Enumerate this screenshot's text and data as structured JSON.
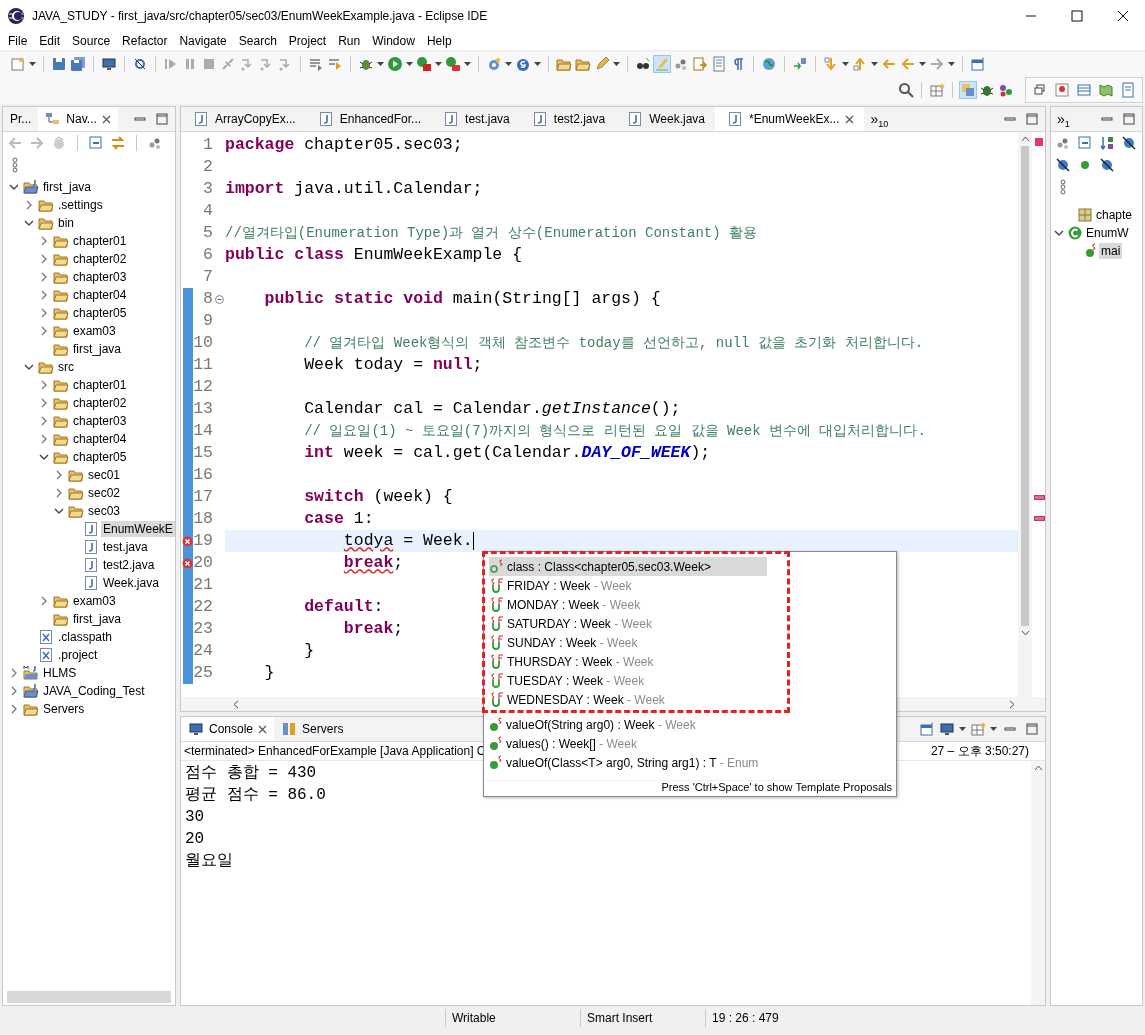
{
  "window": {
    "title": "JAVA_STUDY - first_java/src/chapter05/sec03/EnumWeekExample.java - Eclipse IDE"
  },
  "menu": [
    "File",
    "Edit",
    "Source",
    "Refactor",
    "Navigate",
    "Search",
    "Project",
    "Run",
    "Window",
    "Help"
  ],
  "navigator": {
    "tabs": [
      {
        "label": "Pr...",
        "selected": false
      },
      {
        "label": "Nav...",
        "selected": true
      }
    ],
    "tree": [
      {
        "label": "first_java",
        "kind": "project",
        "expandable": true,
        "expanded": true,
        "selected": false,
        "children": [
          {
            "label": ".settings",
            "kind": "folder",
            "expandable": true,
            "expanded": false,
            "selected": false
          },
          {
            "label": "bin",
            "kind": "folder",
            "expandable": true,
            "expanded": true,
            "selected": false,
            "children": [
              {
                "label": "chapter01",
                "kind": "folder",
                "expandable": true,
                "expanded": false,
                "selected": false
              },
              {
                "label": "chapter02",
                "kind": "folder",
                "expandable": true,
                "expanded": false,
                "selected": false
              },
              {
                "label": "chapter03",
                "kind": "folder",
                "expandable": true,
                "expanded": false,
                "selected": false
              },
              {
                "label": "chapter04",
                "kind": "folder",
                "expandable": true,
                "expanded": false,
                "selected": false
              },
              {
                "label": "chapter05",
                "kind": "folder",
                "expandable": true,
                "expanded": false,
                "selected": false
              },
              {
                "label": "exam03",
                "kind": "folder",
                "expandable": true,
                "expanded": false,
                "selected": false
              },
              {
                "label": "first_java",
                "kind": "folder",
                "expandable": false,
                "selected": false
              }
            ]
          },
          {
            "label": "src",
            "kind": "folder",
            "expandable": true,
            "expanded": true,
            "selected": false,
            "children": [
              {
                "label": "chapter01",
                "kind": "folder",
                "expandable": true,
                "expanded": false,
                "selected": false
              },
              {
                "label": "chapter02",
                "kind": "folder",
                "expandable": true,
                "expanded": false,
                "selected": false
              },
              {
                "label": "chapter03",
                "kind": "folder",
                "expandable": true,
                "expanded": false,
                "selected": false
              },
              {
                "label": "chapter04",
                "kind": "folder",
                "expandable": true,
                "expanded": false,
                "selected": false
              },
              {
                "label": "chapter05",
                "kind": "folder",
                "expandable": true,
                "expanded": true,
                "selected": false,
                "children": [
                  {
                    "label": "sec01",
                    "kind": "folder",
                    "expandable": true,
                    "expanded": false,
                    "selected": false
                  },
                  {
                    "label": "sec02",
                    "kind": "folder",
                    "expandable": true,
                    "expanded": false,
                    "selected": false
                  },
                  {
                    "label": "sec03",
                    "kind": "folder",
                    "expandable": true,
                    "expanded": true,
                    "selected": false,
                    "children": [
                      {
                        "label": "EnumWeekE",
                        "kind": "java",
                        "expandable": false,
                        "selected": true
                      },
                      {
                        "label": "test.java",
                        "kind": "java",
                        "expandable": false,
                        "selected": false
                      },
                      {
                        "label": "test2.java",
                        "kind": "java",
                        "expandable": false,
                        "selected": false
                      },
                      {
                        "label": "Week.java",
                        "kind": "java",
                        "expandable": false,
                        "selected": false
                      }
                    ]
                  }
                ]
              },
              {
                "label": "exam03",
                "kind": "folder",
                "expandable": true,
                "expanded": false,
                "selected": false
              },
              {
                "label": "first_java",
                "kind": "folder",
                "expandable": false,
                "selected": false
              }
            ]
          },
          {
            "label": ".classpath",
            "kind": "xml",
            "expandable": false,
            "selected": false
          },
          {
            "label": ".project",
            "kind": "xml",
            "expandable": false,
            "selected": false
          }
        ]
      },
      {
        "label": "HLMS",
        "kind": "project-maven",
        "expandable": true,
        "expanded": false,
        "selected": false
      },
      {
        "label": "JAVA_Coding_Test",
        "kind": "project",
        "expandable": true,
        "expanded": false,
        "selected": false
      },
      {
        "label": "Servers",
        "kind": "folder",
        "expandable": true,
        "expanded": false,
        "selected": false
      }
    ]
  },
  "editor": {
    "tabs": [
      {
        "label": "ArrayCopyEx...",
        "selected": false
      },
      {
        "label": "EnhancedFor...",
        "selected": false
      },
      {
        "label": "test.java",
        "selected": false
      },
      {
        "label": "test2.java",
        "selected": false
      },
      {
        "label": "Week.java",
        "selected": false
      },
      {
        "label": "*EnumWeekEx...",
        "selected": true
      }
    ],
    "overflow": {
      "glyph": "»",
      "count": "10"
    },
    "lines": [
      {
        "number": "1",
        "current": false,
        "error": false,
        "fold": false,
        "in_range": false,
        "segments": [
          {
            "kind": "keyword",
            "text": "package"
          },
          {
            "kind": "plain",
            "text": " chapter05.sec03;"
          }
        ]
      },
      {
        "number": "2",
        "current": false,
        "error": false,
        "fold": false,
        "in_range": false
      },
      {
        "number": "3",
        "current": false,
        "error": false,
        "fold": false,
        "in_range": false,
        "segments": [
          {
            "kind": "keyword",
            "text": "import"
          },
          {
            "kind": "plain",
            "text": " java.util.Calendar;"
          }
        ]
      },
      {
        "number": "4",
        "current": false,
        "error": false,
        "fold": false,
        "in_range": false
      },
      {
        "number": "5",
        "current": false,
        "error": false,
        "fold": false,
        "in_range": false,
        "segments": [
          {
            "kind": "comment",
            "text": "//열겨타입(Enumeration Type)과 열거 상수(Enumeration Constant) 활용"
          }
        ]
      },
      {
        "number": "6",
        "current": false,
        "error": false,
        "fold": false,
        "in_range": false,
        "segments": [
          {
            "kind": "keyword",
            "text": "public"
          },
          {
            "kind": "keyword",
            "text": " class"
          },
          {
            "kind": "plain",
            "text": " EnumWeekExample {"
          }
        ]
      },
      {
        "number": "7",
        "current": false,
        "error": false,
        "fold": false,
        "in_range": false
      },
      {
        "number": "8",
        "current": false,
        "error": false,
        "fold": true,
        "in_range": true,
        "segments": [
          {
            "kind": "keyword",
            "text": "    public"
          },
          {
            "kind": "keyword",
            "text": " static"
          },
          {
            "kind": "keyword",
            "text": " void"
          },
          {
            "kind": "plain",
            "text": " main(String[] args) {"
          }
        ]
      },
      {
        "number": "9",
        "current": false,
        "error": false,
        "fold": false,
        "in_range": true
      },
      {
        "number": "10",
        "current": false,
        "error": false,
        "fold": false,
        "in_range": true,
        "segments": [
          {
            "kind": "comment",
            "text": "        // 열겨타입 Week형식의 객체 참조변수 today를 선언하고, null 값을 초기화 처리합니다."
          }
        ]
      },
      {
        "number": "11",
        "current": false,
        "error": false,
        "fold": false,
        "in_range": true,
        "segments": [
          {
            "kind": "plain",
            "text": "        Week today = "
          },
          {
            "kind": "keyword",
            "text": "null"
          },
          {
            "kind": "plain",
            "text": ";"
          }
        ]
      },
      {
        "number": "12",
        "current": false,
        "error": false,
        "fold": false,
        "in_range": true
      },
      {
        "number": "13",
        "current": false,
        "error": false,
        "fold": false,
        "in_range": true,
        "segments": [
          {
            "kind": "plain",
            "text": "        Calendar cal = Calendar."
          },
          {
            "kind": "static-method",
            "text": "getInstance"
          },
          {
            "kind": "plain",
            "text": "();"
          }
        ]
      },
      {
        "number": "14",
        "current": false,
        "error": false,
        "fold": false,
        "in_range": true,
        "segments": [
          {
            "kind": "comment",
            "text": "        // 일요일(1) ~ 토요일(7)까지의 형식으로 리턴된 요일 값을 Week 변수에 대입처리합니다."
          }
        ]
      },
      {
        "number": "15",
        "current": false,
        "error": false,
        "fold": false,
        "in_range": true,
        "segments": [
          {
            "kind": "keyword",
            "text": "        int"
          },
          {
            "kind": "plain",
            "text": " week = cal.get(Calendar."
          },
          {
            "kind": "static-field",
            "text": "DAY_OF_WEEK"
          },
          {
            "kind": "plain",
            "text": ");"
          }
        ]
      },
      {
        "number": "16",
        "current": false,
        "error": false,
        "fold": false,
        "in_range": true
      },
      {
        "number": "17",
        "current": false,
        "error": false,
        "fold": false,
        "in_range": true,
        "segments": [
          {
            "kind": "keyword",
            "text": "        switch"
          },
          {
            "kind": "plain",
            "text": " (week) {"
          }
        ]
      },
      {
        "number": "18",
        "current": false,
        "error": false,
        "fold": false,
        "in_range": true,
        "segments": [
          {
            "kind": "keyword",
            "text": "        case"
          },
          {
            "kind": "plain",
            "text": " 1:"
          }
        ]
      },
      {
        "number": "19",
        "current": true,
        "error": true,
        "fold": false,
        "in_range": true,
        "segments": [
          {
            "kind": "error",
            "text": "            todya"
          },
          {
            "kind": "plain",
            "text": " = Week."
          }
        ]
      },
      {
        "number": "20",
        "current": false,
        "error": true,
        "fold": false,
        "in_range": true,
        "segments": [
          {
            "kind": "error-keyword",
            "text": "            break"
          },
          {
            "kind": "plain",
            "text": ";"
          }
        ]
      },
      {
        "number": "21",
        "current": false,
        "error": false,
        "fold": false,
        "in_range": true
      },
      {
        "number": "22",
        "current": false,
        "error": false,
        "fold": false,
        "in_range": true,
        "segments": [
          {
            "kind": "keyword",
            "text": "        default"
          },
          {
            "kind": "plain",
            "text": ":"
          }
        ]
      },
      {
        "number": "23",
        "current": false,
        "error": false,
        "fold": false,
        "in_range": true,
        "segments": [
          {
            "kind": "keyword",
            "text": "            break"
          },
          {
            "kind": "plain",
            "text": ";"
          }
        ]
      },
      {
        "number": "24",
        "current": false,
        "error": false,
        "fold": false,
        "in_range": true,
        "segments": [
          {
            "kind": "plain",
            "text": "        }"
          }
        ]
      },
      {
        "number": "25",
        "current": false,
        "error": false,
        "fold": false,
        "in_range": true,
        "segments": [
          {
            "kind": "plain",
            "text": "    }"
          }
        ]
      }
    ]
  },
  "completion_popup": {
    "groups": [
      {
        "highlighted": true,
        "items": [
          {
            "kind": "static-field",
            "label": "class : Class<chapter05.sec03.Week>",
            "selected": true
          },
          {
            "kind": "constant",
            "label": "FRIDAY : Week",
            "qualifier": "- Week",
            "selected": false
          },
          {
            "kind": "constant",
            "label": "MONDAY : Week",
            "qualifier": "- Week",
            "selected": false
          },
          {
            "kind": "constant",
            "label": "SATURDAY : Week",
            "qualifier": "- Week",
            "selected": false
          },
          {
            "kind": "constant",
            "label": "SUNDAY : Week",
            "qualifier": "- Week",
            "selected": false
          },
          {
            "kind": "constant",
            "label": "THURSDAY : Week",
            "qualifier": "- Week",
            "selected": false
          },
          {
            "kind": "constant",
            "label": "TUESDAY : Week",
            "qualifier": "- Week",
            "selected": false
          },
          {
            "kind": "constant",
            "label": "WEDNESDAY : Week",
            "qualifier": "- Week",
            "selected": false
          }
        ]
      },
      {
        "highlighted": false,
        "items": [
          {
            "kind": "static-method",
            "label": "valueOf(String arg0) : Week",
            "qualifier": "- Week",
            "selected": false
          },
          {
            "kind": "static-method",
            "label": "values() : Week[]",
            "qualifier": "- Week",
            "selected": false
          },
          {
            "kind": "static-method",
            "label": "valueOf(Class<T> arg0, String arg1) : T",
            "qualifier": "- Enum",
            "selected": false
          }
        ]
      }
    ],
    "hint": "Press 'Ctrl+Space' to show Template Proposals"
  },
  "outline": {
    "overflow": {
      "glyph": "»",
      "count": "1"
    },
    "tree": [
      {
        "label": "chapte",
        "kind": "package",
        "expandable": false,
        "selected": false
      },
      {
        "label": "EnumW",
        "kind": "class",
        "expandable": true,
        "expanded": true,
        "selected": false,
        "children": [
          {
            "label": "mai",
            "kind": "method",
            "expandable": false,
            "selected": true
          }
        ]
      }
    ]
  },
  "console": {
    "tabs": [
      {
        "label": "Console",
        "selected": true
      },
      {
        "label": "Servers",
        "selected": false
      }
    ],
    "header_left": "<terminated> EnhancedForExample [Java Application] C",
    "header_right": "27 – 오후 3:50:27)",
    "output": [
      "점수 총합 = 430",
      "평균 점수 = 86.0",
      "30",
      "20",
      "월요일"
    ]
  },
  "status_bar": [
    "Writable",
    "Smart Insert",
    "19 : 26 : 479"
  ]
}
